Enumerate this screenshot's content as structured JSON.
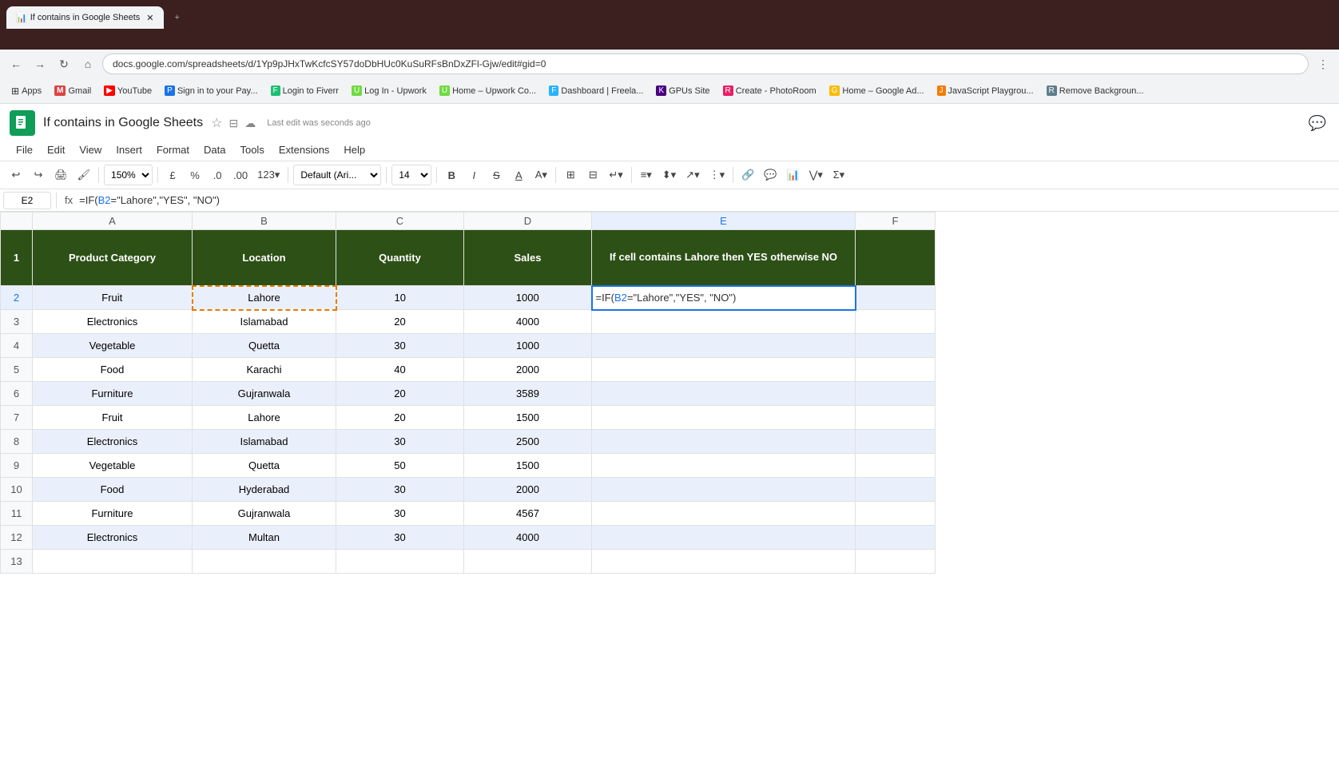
{
  "browser": {
    "address": "docs.google.com/spreadsheets/d/1Yp9pJHxTwKcfcSY57doDbHUc0KuSuRFsBnDxZFl-Gjw/edit#gid=0",
    "tabs": [
      {
        "label": "Apps",
        "icon": "⊞",
        "active": false
      },
      {
        "label": "Gmail",
        "icon": "M",
        "active": false
      },
      {
        "label": "YouTube",
        "icon": "▶",
        "active": false
      },
      {
        "label": "Sign in to your Pay...",
        "icon": "P",
        "active": false
      },
      {
        "label": "Login to Fiverr",
        "icon": "F",
        "active": false
      },
      {
        "label": "Log In - Upwork",
        "icon": "U",
        "active": false
      },
      {
        "label": "Home – Upwork Co...",
        "icon": "U",
        "active": false
      },
      {
        "label": "Dashboard | Freela...",
        "icon": "F",
        "active": false
      },
      {
        "label": "GPUs Site",
        "icon": "K",
        "active": false
      },
      {
        "label": "Create - PhotoRoom",
        "icon": "R",
        "active": false
      },
      {
        "label": "Home – Google Ad...",
        "icon": "G",
        "active": false
      },
      {
        "label": "JavaScript Playgrou...",
        "icon": "J",
        "active": false
      },
      {
        "label": "Remove Backgroun...",
        "icon": "R",
        "active": false
      }
    ]
  },
  "sheets": {
    "title": "If contains in Google Sheets",
    "last_edit": "Last edit was seconds ago",
    "menus": [
      "File",
      "Edit",
      "View",
      "Insert",
      "Format",
      "Data",
      "Tools",
      "Extensions",
      "Help"
    ],
    "cell_ref": "E2",
    "formula": "=IF(B2=\"Lahore\",\"YES\", \"NO\")",
    "zoom": "150%",
    "font_name": "Default (Ari...",
    "font_size": "14"
  },
  "spreadsheet": {
    "headers": {
      "col_a": "Product Category",
      "col_b": "Location",
      "col_c": "Quantity",
      "col_d": "Sales",
      "col_e": "If cell contains Lahore then YES otherwise NO"
    },
    "rows": [
      {
        "row": 2,
        "a": "Fruit",
        "b": "Lahore",
        "c": "10",
        "d": "1000"
      },
      {
        "row": 3,
        "a": "Electronics",
        "b": "Islamabad",
        "c": "20",
        "d": "4000"
      },
      {
        "row": 4,
        "a": "Vegetable",
        "b": "Quetta",
        "c": "30",
        "d": "1000"
      },
      {
        "row": 5,
        "a": "Food",
        "b": "Karachi",
        "c": "40",
        "d": "2000"
      },
      {
        "row": 6,
        "a": "Furniture",
        "b": "Gujranwala",
        "c": "20",
        "d": "3589"
      },
      {
        "row": 7,
        "a": "Fruit",
        "b": "Lahore",
        "c": "20",
        "d": "1500"
      },
      {
        "row": 8,
        "a": "Electronics",
        "b": "Islamabad",
        "c": "30",
        "d": "2500"
      },
      {
        "row": 9,
        "a": "Vegetable",
        "b": "Quetta",
        "c": "50",
        "d": "1500"
      },
      {
        "row": 10,
        "a": "Food",
        "b": "Hyderabad",
        "c": "30",
        "d": "2000"
      },
      {
        "row": 11,
        "a": "Furniture",
        "b": "Gujranwala",
        "c": "30",
        "d": "4567"
      },
      {
        "row": 12,
        "a": "Electronics",
        "b": "Multan",
        "c": "30",
        "d": "4000"
      }
    ],
    "e2_formula": "=IF(B2=\"Lahore\",\"YES\", \"NO\")"
  }
}
